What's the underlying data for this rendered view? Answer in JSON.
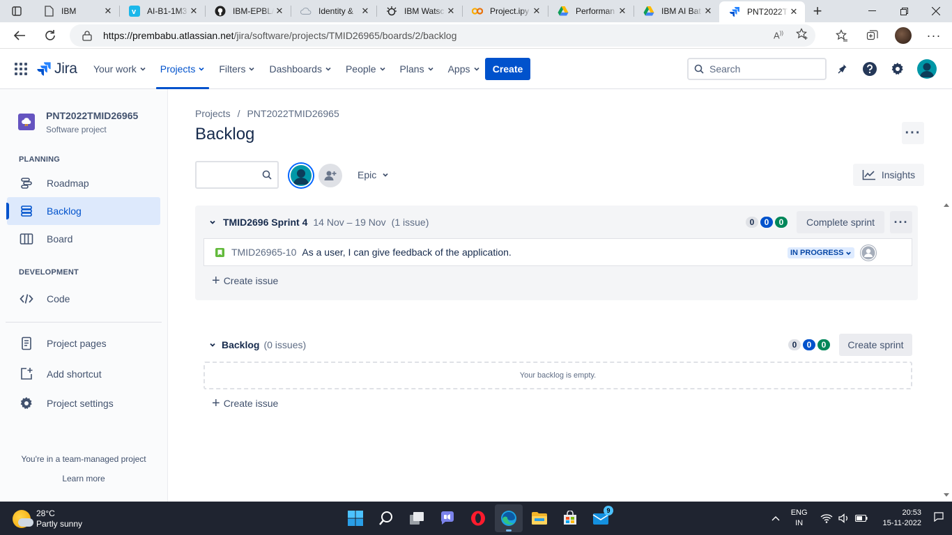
{
  "browser": {
    "tabs": [
      {
        "title": "IBM",
        "icon": "page-icon"
      },
      {
        "title": "AI-B1-1M3",
        "icon": "vimeo-icon"
      },
      {
        "title": "IBM-EPBL/",
        "icon": "github-icon"
      },
      {
        "title": "Identity &",
        "icon": "cloud-icon"
      },
      {
        "title": "IBM Watsc",
        "icon": "watson-icon"
      },
      {
        "title": "Project.ipy",
        "icon": "colab-icon"
      },
      {
        "title": "Performan",
        "icon": "drive-icon"
      },
      {
        "title": "IBM AI Bat",
        "icon": "drive-icon"
      },
      {
        "title": "PNT2022T",
        "icon": "jira-icon"
      }
    ],
    "url_host": "https://prembabu.atlassian.net",
    "url_path": "/jira/software/projects/TMID26965/boards/2/backlog"
  },
  "topnav": {
    "logo": "Jira",
    "menu": [
      "Your work",
      "Projects",
      "Filters",
      "Dashboards",
      "People",
      "Plans",
      "Apps"
    ],
    "active_menu": "Projects",
    "create": "Create",
    "search_placeholder": "Search"
  },
  "sidebar": {
    "project_name": "PNT2022TMID26965",
    "project_type": "Software project",
    "planning_header": "PLANNING",
    "development_header": "DEVELOPMENT",
    "items": {
      "roadmap": "Roadmap",
      "backlog": "Backlog",
      "board": "Board",
      "code": "Code",
      "project_pages": "Project pages",
      "add_shortcut": "Add shortcut",
      "project_settings": "Project settings"
    },
    "footer_text": "You're in a team-managed project",
    "learn_more": "Learn more"
  },
  "main": {
    "breadcrumb_projects": "Projects",
    "breadcrumb_sep": "/",
    "breadcrumb_project": "PNT2022TMID26965",
    "title": "Backlog",
    "epic": "Epic",
    "insights": "Insights",
    "sprint": {
      "name": "TMID2696 Sprint 4",
      "dates": "14 Nov – 19 Nov",
      "count": "(1 issue)",
      "todo": "0",
      "inprogress": "0",
      "done": "0",
      "complete_button": "Complete sprint",
      "issue": {
        "key": "TMID26965-10",
        "summary": "As a user, I can give feedback of the application.",
        "status": "IN PROGRESS"
      },
      "create_issue": "Create issue"
    },
    "backlog": {
      "name": "Backlog",
      "count": "(0 issues)",
      "todo": "0",
      "inprogress": "0",
      "done": "0",
      "create_sprint": "Create sprint",
      "empty": "Your backlog is empty.",
      "create_issue": "Create issue"
    }
  },
  "taskbar": {
    "temp": "28°C",
    "weather": "Partly sunny",
    "lang1": "ENG",
    "lang2": "IN",
    "time": "20:53",
    "date": "15-11-2022",
    "mail_badge": "9"
  },
  "colors": {
    "jira_blue": "#0052cc",
    "sprint_bg": "#f4f5f7",
    "status_bg": "#deebff",
    "story_green": "#63ba3c",
    "done_green": "#00875a"
  }
}
